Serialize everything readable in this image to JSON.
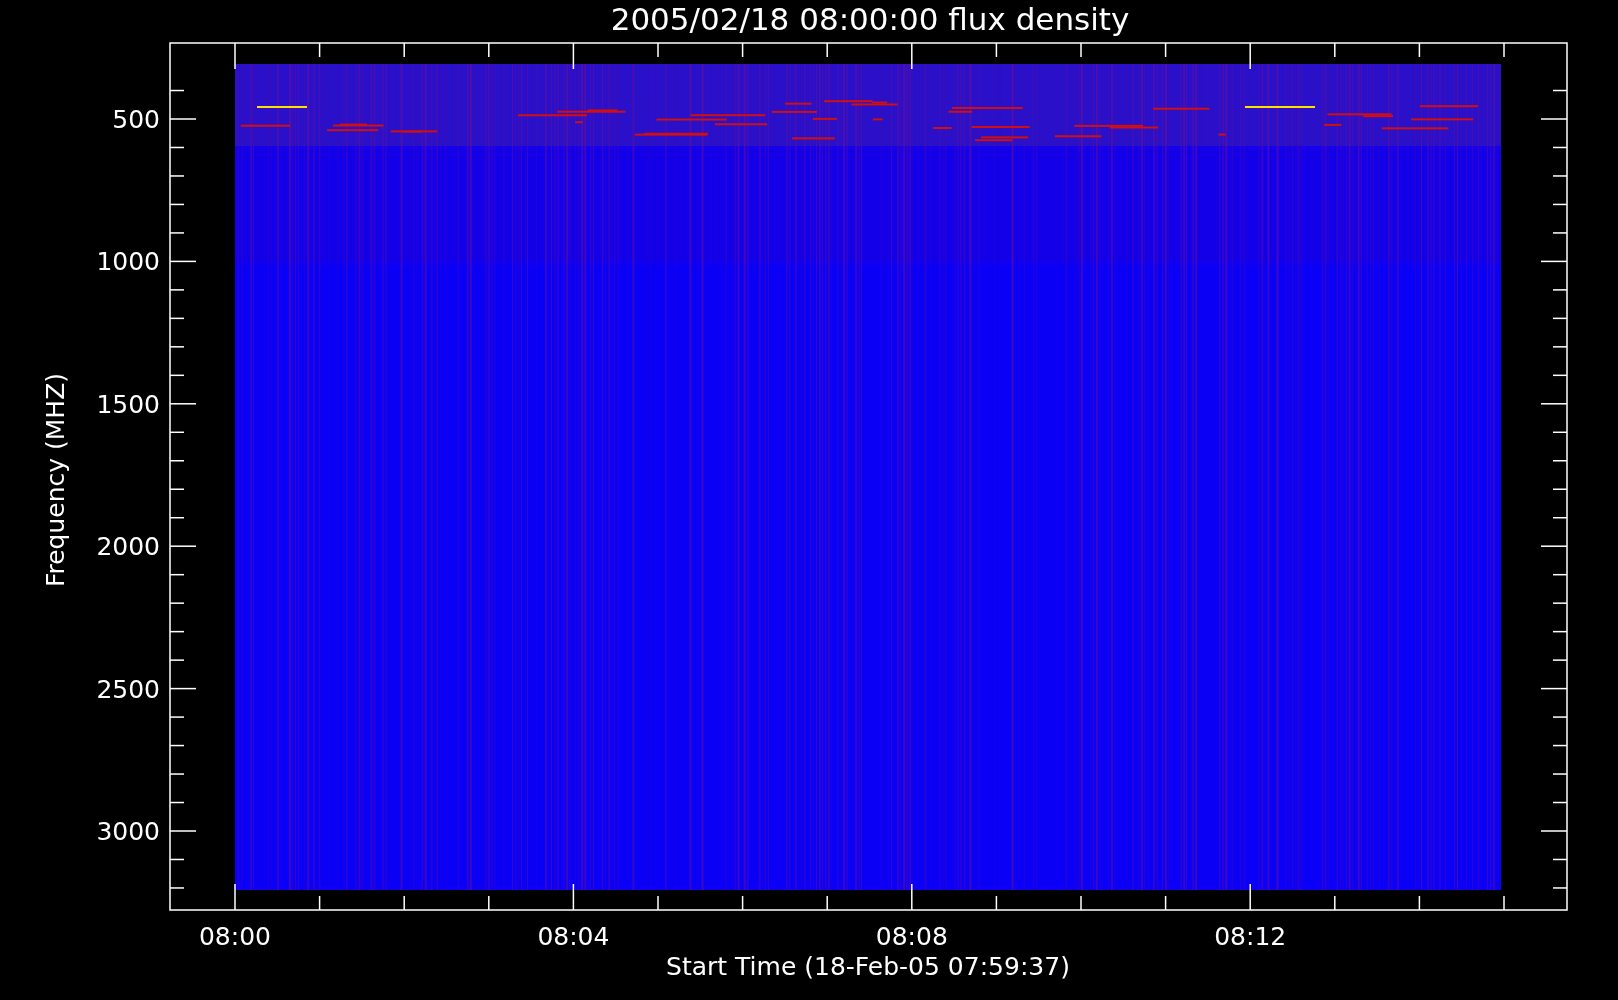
{
  "title": "2005/02/18 08:00:00 flux density",
  "y_axis": {
    "label": "Frequency (MHZ)",
    "ticks": [
      "500",
      "1000",
      "1500",
      "2000",
      "2500",
      "3000"
    ]
  },
  "x_axis": {
    "label": "Start Time (18-Feb-05 07:59:37)",
    "ticks": [
      "08:00",
      "08:04",
      "08:08",
      "08:12"
    ]
  }
}
